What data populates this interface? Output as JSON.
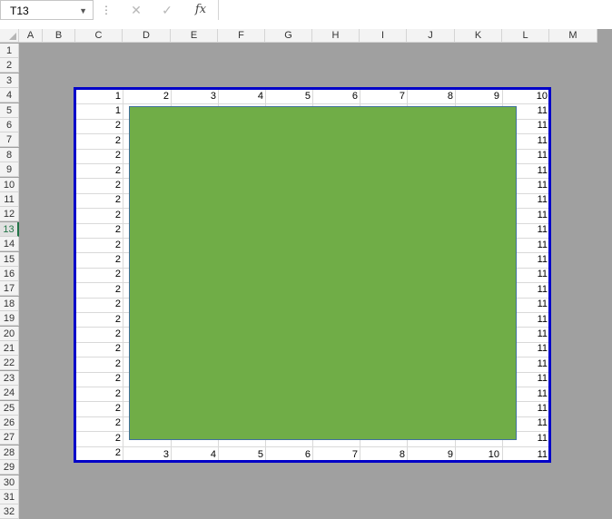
{
  "formula_bar": {
    "name_box": "T13",
    "cancel_icon": "close-icon",
    "enter_icon": "check-icon",
    "fx_label": "fx"
  },
  "columns": [
    "A",
    "B",
    "C",
    "D",
    "E",
    "F",
    "G",
    "H",
    "I",
    "J",
    "K",
    "L",
    "M"
  ],
  "rows": [
    "1",
    "2",
    "3",
    "4",
    "5",
    "6",
    "7",
    "8",
    "9",
    "10",
    "11",
    "12",
    "13",
    "14",
    "15",
    "16",
    "17",
    "18",
    "19",
    "20",
    "21",
    "22",
    "23",
    "24",
    "25",
    "26",
    "27",
    "28",
    "29",
    "30",
    "31",
    "32"
  ],
  "selected_row": "13",
  "sheet": {
    "top_row_values": [
      "1",
      "2",
      "3",
      "4",
      "5",
      "6",
      "7",
      "8",
      "9",
      "10"
    ],
    "left_col_values": [
      "1",
      "2",
      "2",
      "2",
      "2",
      "2",
      "2",
      "2",
      "2",
      "2",
      "2",
      "2",
      "2",
      "2",
      "2",
      "2",
      "2",
      "2",
      "2",
      "2",
      "2",
      "2",
      "2",
      "2"
    ],
    "right_col_values": [
      "11",
      "11",
      "11",
      "11",
      "11",
      "11",
      "11",
      "11",
      "11",
      "11",
      "11",
      "11",
      "11",
      "11",
      "11",
      "11",
      "11",
      "11",
      "11",
      "11",
      "11",
      "11",
      "11"
    ],
    "bottom_row_values": [
      "3",
      "4",
      "5",
      "6",
      "7",
      "8",
      "9",
      "10"
    ],
    "rect_color": "#70ad47",
    "page_border_color": "#0000c8"
  }
}
